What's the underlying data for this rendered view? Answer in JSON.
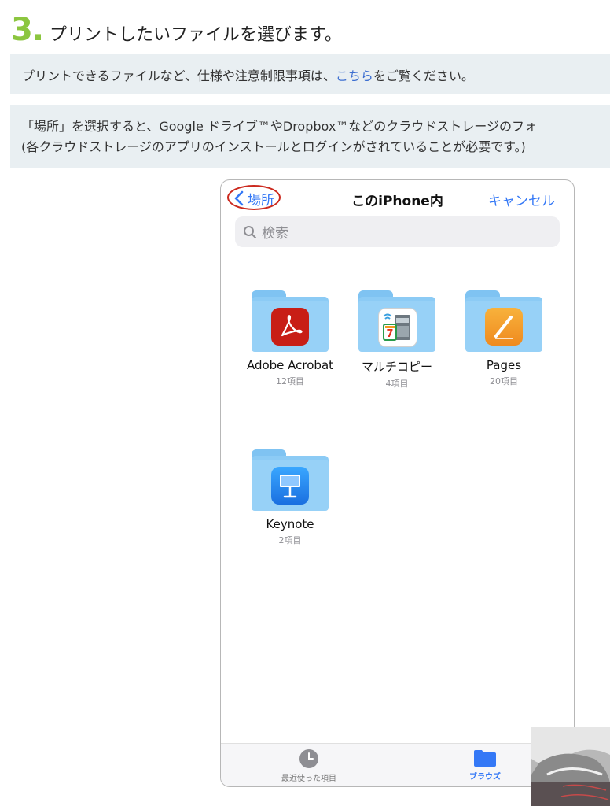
{
  "step": {
    "number": "3.",
    "title": "プリントしたいファイルを選びます。"
  },
  "note1": {
    "before": "プリントできるファイルなど、仕様や注意制限事項は、",
    "link": "こちら",
    "after": "をご覧ください。"
  },
  "note2": {
    "line1": "「場所」を選択すると、Google ドライブ™やDropbox™などのクラウドストレージのフォ",
    "line2": "(各クラウドストレージのアプリのインストールとログインがされていることが必要です。)"
  },
  "picker": {
    "back_label": "場所",
    "title": "このiPhone内",
    "cancel_label": "キャンセル",
    "search_placeholder": "検索",
    "folders": [
      {
        "name": "Adobe Acrobat",
        "count": "12項目",
        "icon": "acrobat-app-icon"
      },
      {
        "name": "マルチコピー",
        "count": "4項目",
        "icon": "multicopy-app-icon"
      },
      {
        "name": "Pages",
        "count": "20項目",
        "icon": "pages-app-icon"
      },
      {
        "name": "Keynote",
        "count": "2項目",
        "icon": "keynote-app-icon"
      }
    ],
    "tabs": [
      {
        "label": "最近使った項目",
        "icon": "clock-icon"
      },
      {
        "label": "ブラウズ",
        "icon": "folder-icon"
      }
    ]
  },
  "colors": {
    "step_green": "#8cc63f",
    "ios_blue": "#3478f6",
    "highlight_red": "#cc2a1f",
    "note_bg": "#e9eff2"
  }
}
